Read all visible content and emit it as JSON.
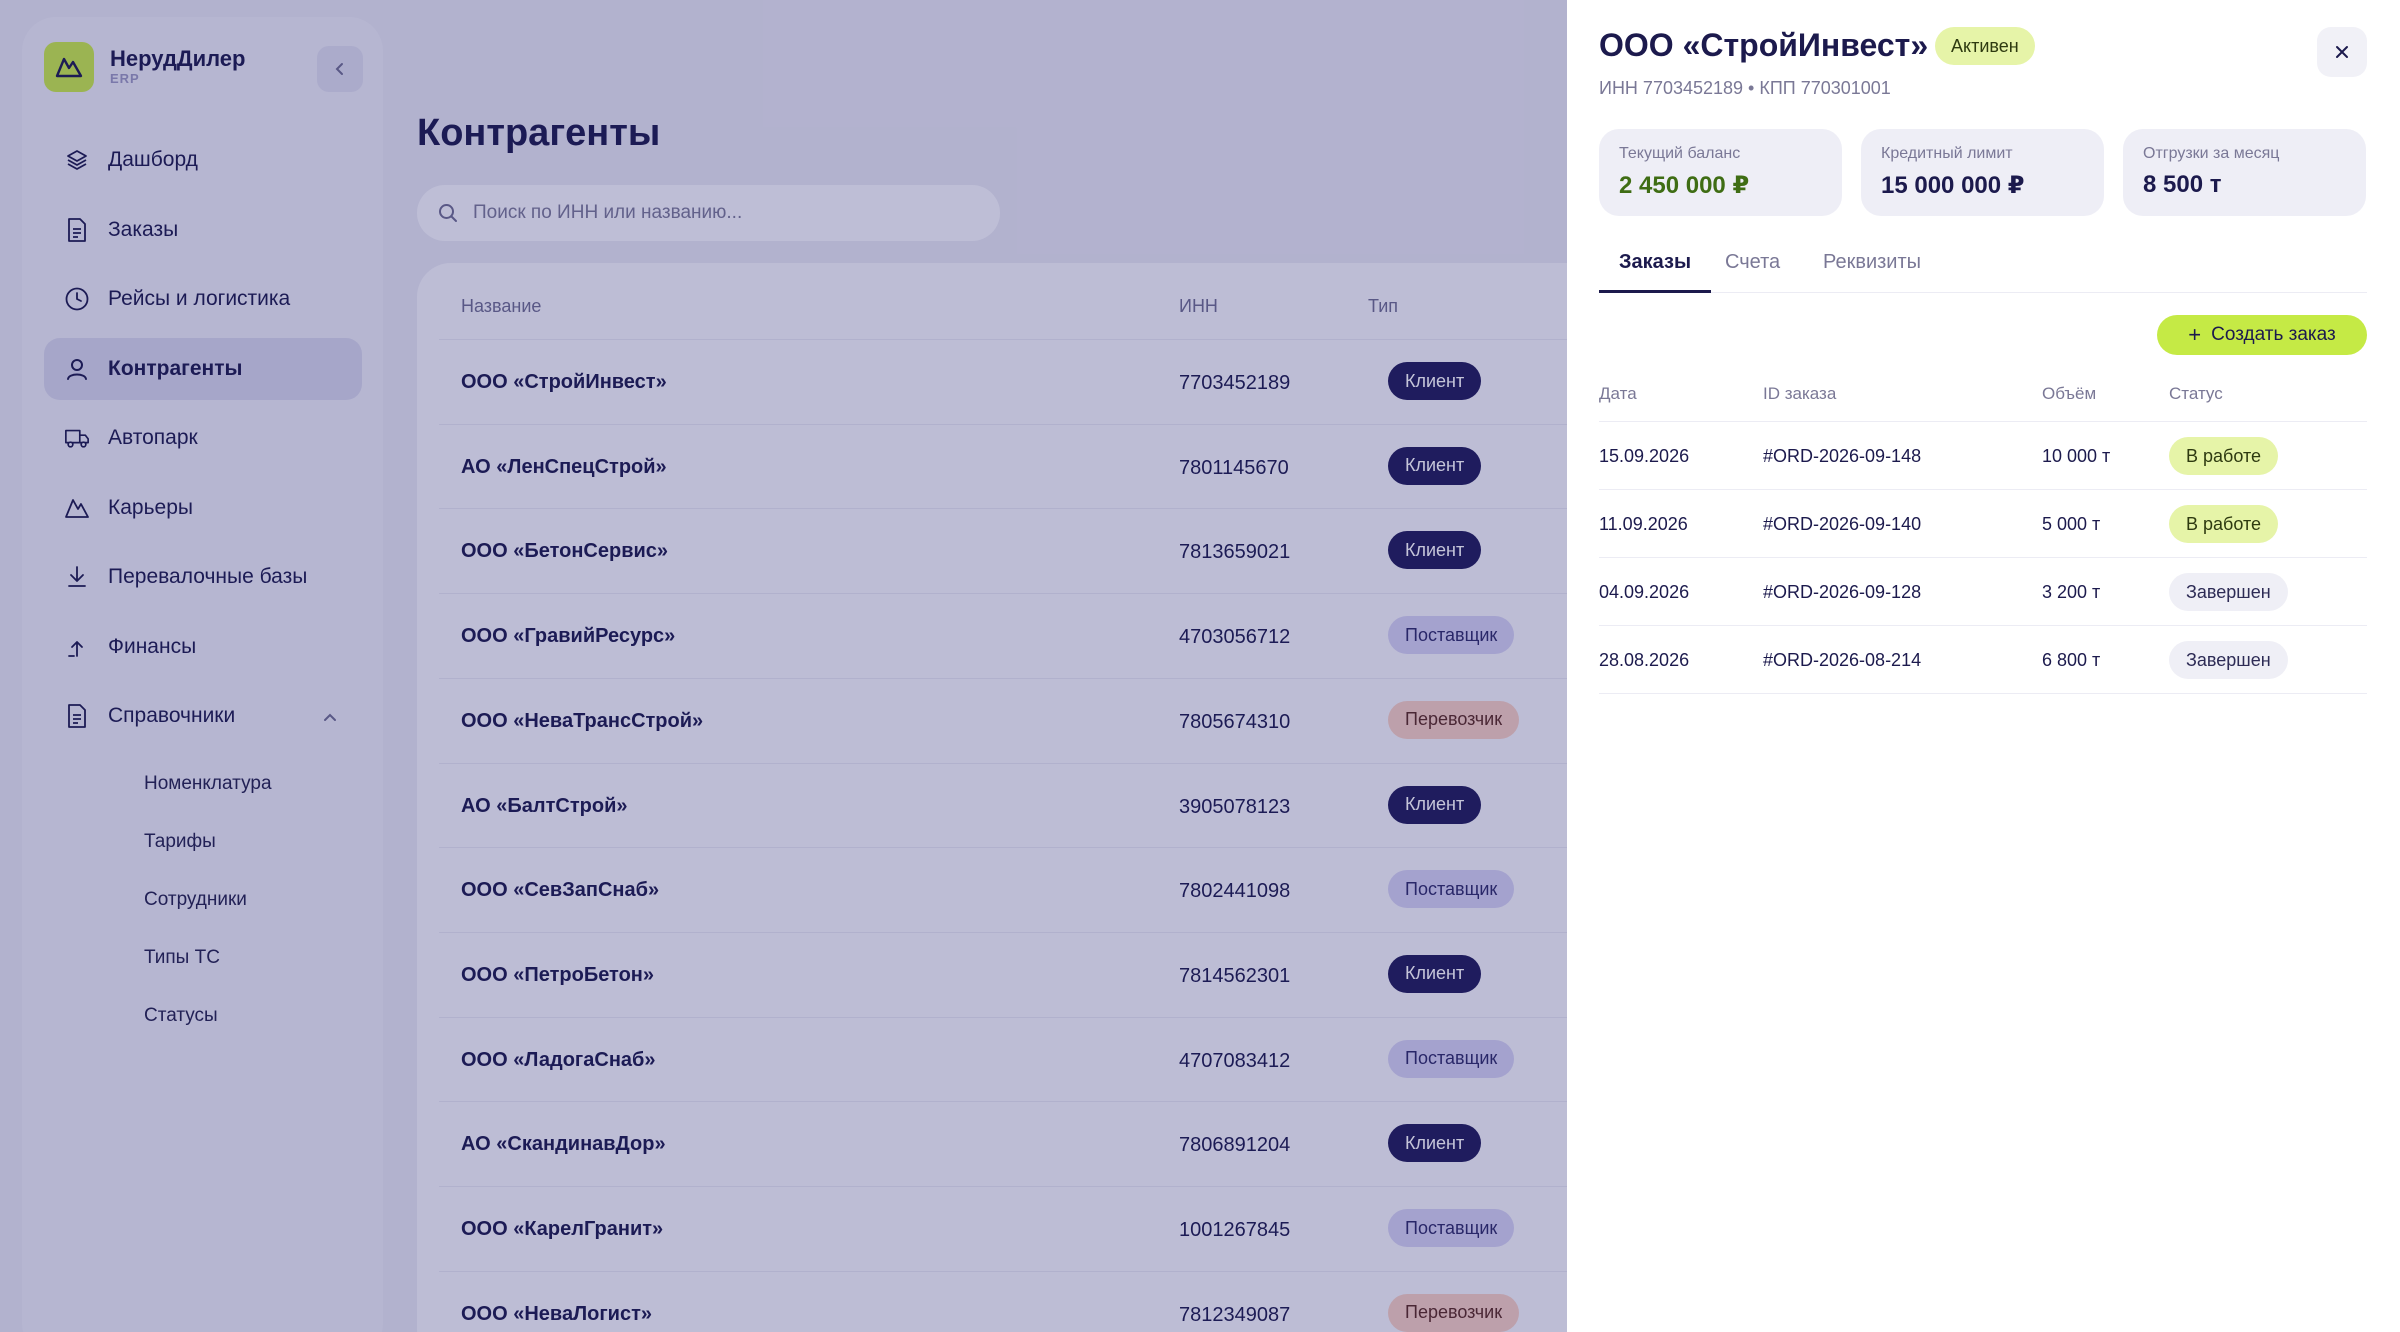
{
  "brand": {
    "name": "НерудДилер",
    "sub": "ERP"
  },
  "nav": {
    "items": [
      {
        "label": "Дашборд",
        "icon": "layers-icon",
        "active": false
      },
      {
        "label": "Заказы",
        "icon": "document-icon",
        "active": false
      },
      {
        "label": "Рейсы и логистика",
        "icon": "clock-icon",
        "active": false
      },
      {
        "label": "Контрагенты",
        "icon": "user-icon",
        "active": true
      },
      {
        "label": "Автопарк",
        "icon": "truck-icon",
        "active": false
      },
      {
        "label": "Карьеры",
        "icon": "mountain-icon",
        "active": false
      },
      {
        "label": "Перевалочные базы",
        "icon": "download-icon",
        "active": false
      },
      {
        "label": "Финансы",
        "icon": "upload-icon",
        "active": false
      },
      {
        "label": "Справочники",
        "icon": "document-icon",
        "active": false,
        "expanded": true
      }
    ],
    "sub_items": [
      "Номенклатура",
      "Тарифы",
      "Сотрудники",
      "Типы ТС",
      "Статусы"
    ]
  },
  "page": {
    "title": "Контрагенты",
    "search_placeholder": "Поиск по ИНН или названию..."
  },
  "table": {
    "columns": [
      "Название",
      "ИНН",
      "Тип"
    ],
    "rows": [
      {
        "name": "ООО «СтройИнвест»",
        "inn": "7703452189",
        "type": "Клиент",
        "kind": "client"
      },
      {
        "name": "АО «ЛенСпецСтрой»",
        "inn": "7801145670",
        "type": "Клиент",
        "kind": "client"
      },
      {
        "name": "ООО «БетонСервис»",
        "inn": "7813659021",
        "type": "Клиент",
        "kind": "client"
      },
      {
        "name": "ООО «ГравийРесурс»",
        "inn": "4703056712",
        "type": "Поставщик",
        "kind": "supplier"
      },
      {
        "name": "ООО «НеваТрансСтрой»",
        "inn": "7805674310",
        "type": "Перевозчик",
        "kind": "carrier"
      },
      {
        "name": "АО «БалтСтрой»",
        "inn": "3905078123",
        "type": "Клиент",
        "kind": "client"
      },
      {
        "name": "ООО «СевЗапСнаб»",
        "inn": "7802441098",
        "type": "Поставщик",
        "kind": "supplier"
      },
      {
        "name": "ООО «ПетроБетон»",
        "inn": "7814562301",
        "type": "Клиент",
        "kind": "client"
      },
      {
        "name": "ООО «ЛадогаСнаб»",
        "inn": "4707083412",
        "type": "Поставщик",
        "kind": "supplier"
      },
      {
        "name": "АО «СкандинавДор»",
        "inn": "7806891204",
        "type": "Клиент",
        "kind": "client"
      },
      {
        "name": "ООО «КарелГранит»",
        "inn": "1001267845",
        "type": "Поставщик",
        "kind": "supplier"
      },
      {
        "name": "ООО «НеваЛогист»",
        "inn": "7812349087",
        "type": "Перевозчик",
        "kind": "carrier"
      }
    ]
  },
  "drawer": {
    "title": "ООО «СтройИнвест»",
    "status": "Активен",
    "subtitle": "ИНН 7703452189 • КПП 770301001",
    "stats": [
      {
        "label": "Текущий баланс",
        "value": "2 450 000 ₽",
        "accent": "#3f6d14"
      },
      {
        "label": "Кредитный лимит",
        "value": "15 000 000 ₽"
      },
      {
        "label": "Отгрузки за месяц",
        "value": "8 500 т"
      }
    ],
    "tabs": [
      "Заказы",
      "Счета",
      "Реквизиты"
    ],
    "create_button": "Создать заказ",
    "orders_columns": [
      "Дата",
      "ID заказа",
      "Объём",
      "Статус"
    ],
    "orders": [
      {
        "date": "15.09.2026",
        "id": "#ORD-2026-09-148",
        "volume": "10 000 т",
        "status": "В работе",
        "kind": "work"
      },
      {
        "date": "11.09.2026",
        "id": "#ORD-2026-09-140",
        "volume": "5 000 т",
        "status": "В работе",
        "kind": "work"
      },
      {
        "date": "04.09.2026",
        "id": "#ORD-2026-09-128",
        "volume": "3 200 т",
        "status": "Завершен",
        "kind": "done"
      },
      {
        "date": "28.08.2026",
        "id": "#ORD-2026-08-214",
        "volume": "6 800 т",
        "status": "Завершен",
        "kind": "done"
      }
    ]
  },
  "colors": {
    "accent": "#c5ea45",
    "primary": "#1f1b5a",
    "supplier_badge": "#d3d0f0",
    "carrier_badge": "#f4cec2"
  }
}
